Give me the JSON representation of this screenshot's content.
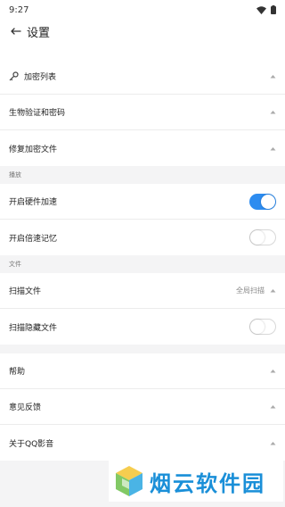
{
  "status": {
    "time": "9:27"
  },
  "header": {
    "title": "设置"
  },
  "groups": [
    {
      "items": [
        {
          "label": "加密列表"
        },
        {
          "label": "生物验证和密码"
        },
        {
          "label": "修复加密文件"
        }
      ]
    }
  ],
  "playback": {
    "section_label": "播放",
    "items": [
      {
        "label": "开启硬件加速",
        "toggle": true
      },
      {
        "label": "开启倍速记忆",
        "toggle": false
      }
    ]
  },
  "files": {
    "section_label": "文件",
    "scan": {
      "label": "扫描文件",
      "value": "全局扫描"
    },
    "hidden": {
      "label": "扫描隐藏文件",
      "toggle": false
    }
  },
  "other": {
    "items": [
      {
        "label": "帮助"
      },
      {
        "label": "意见反馈"
      },
      {
        "label": "关于QQ影音"
      }
    ]
  },
  "watermark": {
    "text": "烟云软件园"
  },
  "colors": {
    "accent": "#2d8cf0",
    "watermark": "#1a8fd8"
  }
}
